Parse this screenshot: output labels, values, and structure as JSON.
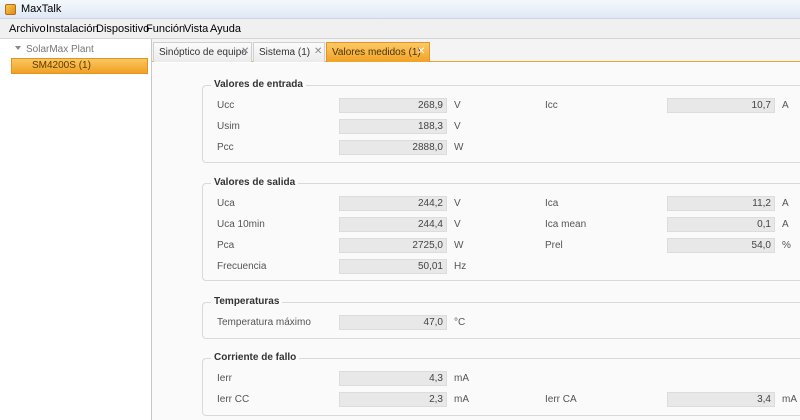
{
  "window": {
    "title": "MaxTalk"
  },
  "menu": [
    "Archivo",
    "Instalación",
    "Dispositivo",
    "Función",
    "Vista",
    "Ayuda"
  ],
  "tree": {
    "root": "SolarMax Plant",
    "node": "SM4200S (1)"
  },
  "tabs": [
    {
      "label": "Sinóptico de equipo",
      "close": "✕"
    },
    {
      "label": "Sistema (1)",
      "close": "✕"
    },
    {
      "label": "Valores medidos (1)",
      "close": "✕"
    }
  ],
  "sections": {
    "entrada": {
      "title": "Valores de entrada",
      "ucc": {
        "label": "Ucc",
        "value": "268,9",
        "unit": "V"
      },
      "icc": {
        "label": "Icc",
        "value": "10,7",
        "unit": "A"
      },
      "usim": {
        "label": "Usim",
        "value": "188,3",
        "unit": "V"
      },
      "pcc": {
        "label": "Pcc",
        "value": "2888,0",
        "unit": "W"
      }
    },
    "salida": {
      "title": "Valores de salida",
      "uca": {
        "label": "Uca",
        "value": "244,2",
        "unit": "V"
      },
      "ica": {
        "label": "Ica",
        "value": "11,2",
        "unit": "A"
      },
      "uca10": {
        "label": "Uca 10min",
        "value": "244,4",
        "unit": "V"
      },
      "icamean": {
        "label": "Ica mean",
        "value": "0,1",
        "unit": "A"
      },
      "pca": {
        "label": "Pca",
        "value": "2725,0",
        "unit": "W"
      },
      "prel": {
        "label": "Prel",
        "value": "54,0",
        "unit": "%"
      },
      "freq": {
        "label": "Frecuencia",
        "value": "50,01",
        "unit": "Hz"
      }
    },
    "temperaturas": {
      "title": "Temperaturas",
      "tmax": {
        "label": "Temperatura máximo",
        "value": "47,0",
        "unit": "°C"
      }
    },
    "fallo": {
      "title": "Corriente de fallo",
      "ierr": {
        "label": "Ierr",
        "value": "4,3",
        "unit": "mA"
      },
      "ierrcc": {
        "label": "Ierr CC",
        "value": "2,3",
        "unit": "mA"
      },
      "ierrca": {
        "label": "Ierr CA",
        "value": "3,4",
        "unit": "mA"
      }
    }
  }
}
